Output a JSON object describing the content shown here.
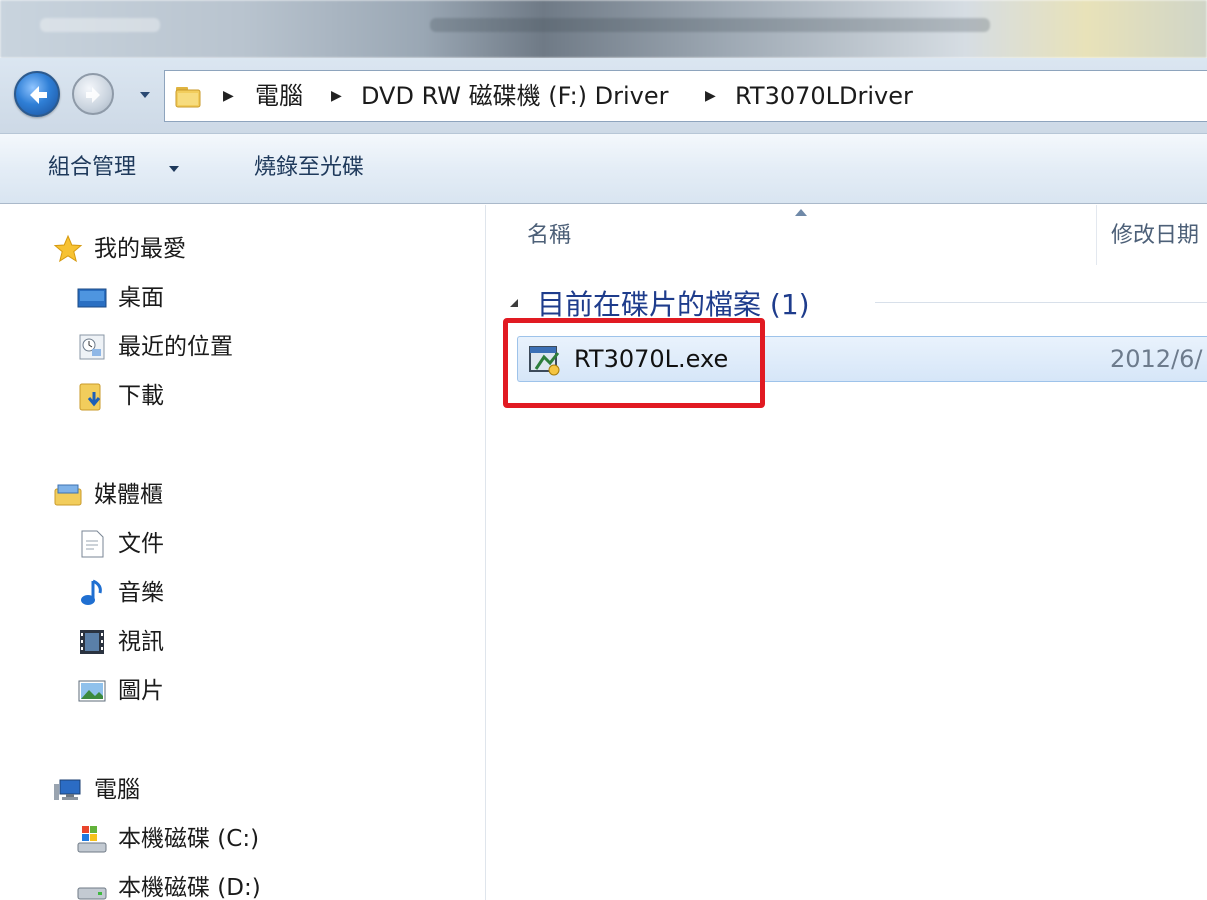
{
  "address_bar": {
    "crumbs": [
      "電腦",
      "DVD RW 磁碟機 (F:) Driver",
      "RT3070LDriver"
    ]
  },
  "command_bar": {
    "organize": "組合管理",
    "burn": "燒錄至光碟"
  },
  "nav_pane": {
    "favorites": {
      "label": "我的最愛",
      "items": [
        "桌面",
        "最近的位置",
        "下載"
      ]
    },
    "libraries": {
      "label": "媒體櫃",
      "items": [
        "文件",
        "音樂",
        "視訊",
        "圖片"
      ]
    },
    "computer": {
      "label": "電腦",
      "items": [
        "本機磁碟 (C:)",
        "本機磁碟 (D:)"
      ]
    }
  },
  "content": {
    "columns": [
      "名稱",
      "修改日期"
    ],
    "column_date_visible": "修改日期",
    "group_title": "目前在碟片的檔案 (1)",
    "files": [
      {
        "name": "RT3070L.exe",
        "date": "2012/6/"
      }
    ]
  },
  "colors": {
    "highlight_box": "#e11a22",
    "group_title": "#1e3c8c",
    "selection_bg": "#d6e6f8"
  }
}
